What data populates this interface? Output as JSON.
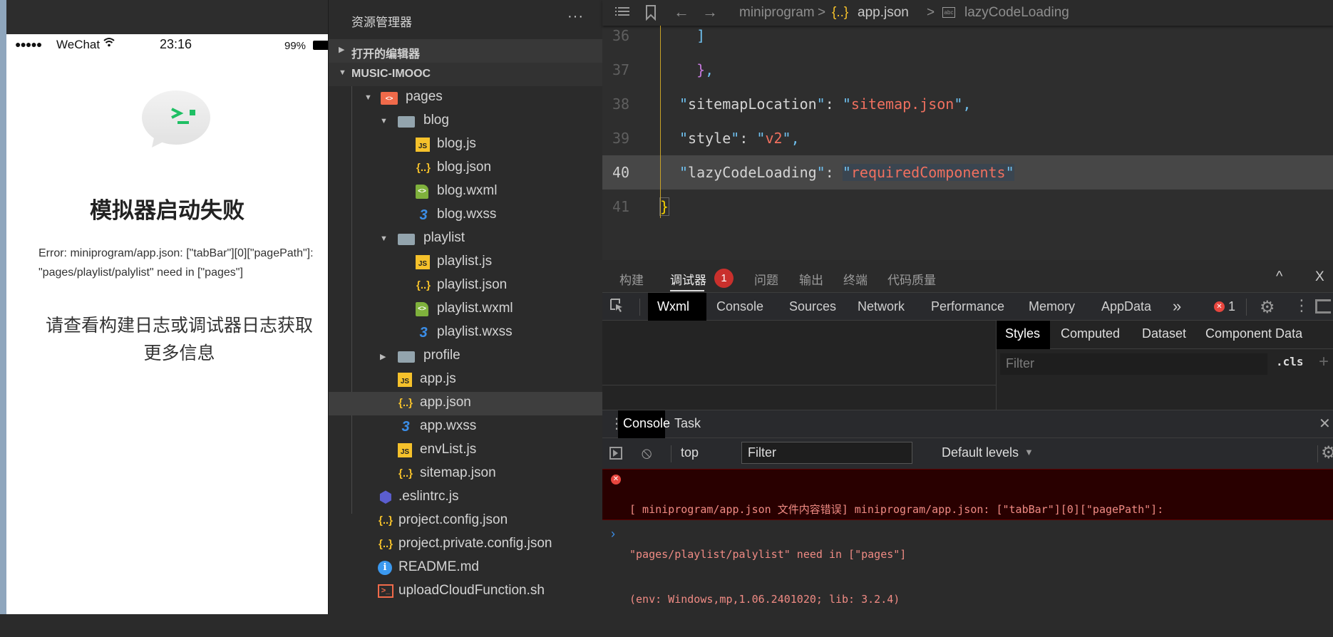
{
  "simulator": {
    "status": {
      "signal": "●●●●●",
      "carrier": "WeChat",
      "wifi_icon": "wifi-icon",
      "time": "23:16",
      "battery": "99%"
    },
    "title": "模拟器启动失败",
    "error_text": "Error: miniprogram/app.json: [\"tabBar\"][0][\"pagePath\"]: \"pages/playlist/palylist\" need in [\"pages\"]",
    "hint": "请查看构建日志或调试器日志获取更多信息",
    "icon": "terminal-bubble-icon"
  },
  "explorer": {
    "title": "资源管理器",
    "more": "···",
    "open_editors": "打开的编辑器",
    "project": "MUSIC-IMOOC",
    "tree": [
      {
        "name": "pages",
        "type": "pages",
        "depth": 0,
        "expanded": true
      },
      {
        "name": "blog",
        "type": "folder",
        "depth": 1,
        "expanded": true
      },
      {
        "name": "blog.js",
        "type": "js",
        "depth": 2
      },
      {
        "name": "blog.json",
        "type": "json",
        "depth": 2
      },
      {
        "name": "blog.wxml",
        "type": "wxml",
        "depth": 2
      },
      {
        "name": "blog.wxss",
        "type": "wxss",
        "depth": 2
      },
      {
        "name": "playlist",
        "type": "folder",
        "depth": 1,
        "expanded": true
      },
      {
        "name": "playlist.js",
        "type": "js",
        "depth": 2
      },
      {
        "name": "playlist.json",
        "type": "json",
        "depth": 2
      },
      {
        "name": "playlist.wxml",
        "type": "wxml",
        "depth": 2
      },
      {
        "name": "playlist.wxss",
        "type": "wxss",
        "depth": 2
      },
      {
        "name": "profile",
        "type": "folder",
        "depth": 1,
        "expanded": false
      },
      {
        "name": "app.js",
        "type": "js",
        "depth": 0
      },
      {
        "name": "app.json",
        "type": "json",
        "depth": 0,
        "selected": true
      },
      {
        "name": "app.wxss",
        "type": "wxss",
        "depth": 0
      },
      {
        "name": "envList.js",
        "type": "js",
        "depth": 0
      },
      {
        "name": "sitemap.json",
        "type": "json",
        "depth": 0
      },
      {
        "name": ".eslintrc.js",
        "type": "eslint",
        "depth": -1
      },
      {
        "name": "project.config.json",
        "type": "json",
        "depth": -1
      },
      {
        "name": "project.private.config.json",
        "type": "json",
        "depth": -1
      },
      {
        "name": "README.md",
        "type": "info",
        "depth": -1
      },
      {
        "name": "uploadCloudFunction.sh",
        "type": "sh",
        "depth": -1
      }
    ]
  },
  "editor": {
    "breadcrumb": [
      "miniprogram",
      "app.json",
      "lazyCodeLoading"
    ],
    "lines": [
      {
        "num": "36",
        "text": "  ]"
      },
      {
        "num": "37",
        "text": "  },"
      },
      {
        "num": "38",
        "key": "sitemapLocation",
        "value": "sitemap.json",
        "comma": true
      },
      {
        "num": "39",
        "key": "style",
        "value": "v2",
        "comma": true
      },
      {
        "num": "40",
        "key": "lazyCodeLoading",
        "value": "requiredComponents",
        "comma": false,
        "current": true
      },
      {
        "num": "41",
        "text": "}"
      }
    ]
  },
  "panel": {
    "tabs": [
      "构建",
      "调试器",
      "问题",
      "输出",
      "终端",
      "代码质量"
    ],
    "active_tab": "调试器",
    "debugger_badge": "1",
    "collapse": "^",
    "close": "X"
  },
  "devtools": {
    "tabs": [
      "Wxml",
      "Console",
      "Sources",
      "Network",
      "Performance",
      "Memory",
      "AppData"
    ],
    "active": "Wxml",
    "more": "»",
    "error_count": "1",
    "styles_tabs": [
      "Styles",
      "Computed",
      "Dataset",
      "Component Data"
    ],
    "styles_filter_placeholder": "Filter",
    "cls": ".cls",
    "plus": "+"
  },
  "console": {
    "drawer_tabs": [
      "Console",
      "Task"
    ],
    "context": "top",
    "filter_placeholder": "Filter",
    "levels": "Default levels",
    "error_lines": [
      "[ miniprogram/app.json 文件内容错误] miniprogram/app.json: [\"tabBar\"][0][\"pagePath\"]:",
      "\"pages/playlist/palylist\" need in [\"pages\"]",
      "(env: Windows,mp,1.06.2401020; lib: 3.2.4)"
    ],
    "prompt": "›"
  }
}
